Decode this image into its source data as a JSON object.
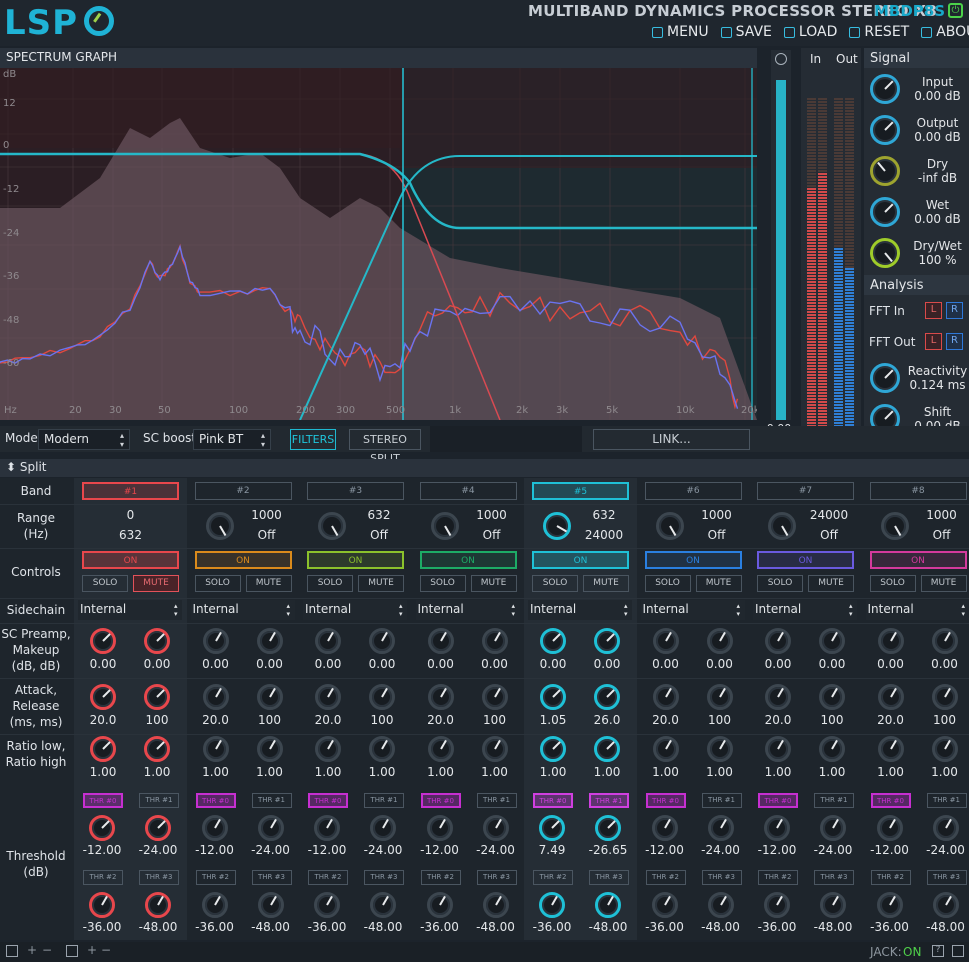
{
  "app": {
    "logo": "LSP",
    "title": "MULTIBAND DYNAMICS PROCESSOR STEREO X8",
    "id": "MBDP8S"
  },
  "menu": [
    {
      "label": "MENU",
      "icon": "menu-icon"
    },
    {
      "label": "SAVE",
      "icon": "save-icon"
    },
    {
      "label": "LOAD",
      "icon": "load-icon"
    },
    {
      "label": "RESET",
      "icon": "reset-icon"
    },
    {
      "label": "ABOUT",
      "icon": "about-icon"
    }
  ],
  "spectrum": {
    "title": "SPECTRUM GRAPH",
    "db_labels": [
      "dB",
      "12",
      "0",
      "-12",
      "-24",
      "-36",
      "-48",
      "-60"
    ],
    "hz_labels": [
      "Hz",
      "20",
      "30",
      "50",
      "100",
      "200",
      "300",
      "500",
      "1k",
      "2k",
      "3k",
      "5k",
      "10k",
      "20k"
    ]
  },
  "meters": {
    "zoom_value": "0.00",
    "zoom_unit": "dB",
    "in_label": "In",
    "out_label": "Out",
    "in_peak": [
      "-8.38",
      "-8.18"
    ],
    "out_peak": [
      "-31.2",
      "-30.8"
    ]
  },
  "signal": {
    "title": "Signal",
    "knobs": [
      {
        "name": "Input",
        "value": "0.00 dB"
      },
      {
        "name": "Output",
        "value": "0.00 dB"
      },
      {
        "name": "Dry",
        "value": "-inf dB"
      },
      {
        "name": "Wet",
        "value": "0.00 dB"
      },
      {
        "name": "Dry/Wet",
        "value": "100 %"
      }
    ]
  },
  "analysis": {
    "title": "Analysis",
    "fft_in": "FFT In",
    "fft_out": "FFT Out",
    "l": "L",
    "r": "R",
    "reactivity_label": "Reactivity",
    "reactivity": "0.124 ms",
    "shift_label": "Shift",
    "shift": "0.00 dB"
  },
  "controls": {
    "mode_label": "Mode:",
    "mode": "Modern",
    "boost_label": "SC boost:",
    "boost": "Pink BT",
    "filters": "FILTERS",
    "stereo_split": "STEREO SPLIT",
    "link": "LINK..."
  },
  "split": {
    "title": "Split",
    "row_labels": {
      "band": "Band",
      "range": "Range\n(Hz)",
      "controls": "Controls",
      "sidechain": "Sidechain",
      "preamp": "SC Preamp,\nMakeup\n(dB, dB)",
      "attack": "Attack,\nRelease\n(ms, ms)",
      "ratio": "Ratio low,\nRatio high",
      "threshold": "Threshold\n(dB)"
    },
    "on": "ON",
    "solo": "SOLO",
    "mute": "MUTE"
  },
  "bands": [
    {
      "label": "#1",
      "color": "#e8474c",
      "active": true,
      "range_top": "0",
      "range_bot": "632",
      "side": "Internal",
      "preamp": "0.00",
      "makeup": "0.00",
      "attack": "20.0",
      "release": "100",
      "rlow": "1.00",
      "rhigh": "1.00",
      "thr": [
        "-12.00",
        "-24.00",
        "-36.00",
        "-48.00"
      ]
    },
    {
      "label": "#2",
      "color": "#d98a1c",
      "active": false,
      "range_top": "1000",
      "range_bot": "Off",
      "side": "Internal",
      "preamp": "0.00",
      "makeup": "0.00",
      "attack": "20.0",
      "release": "100",
      "rlow": "1.00",
      "rhigh": "1.00",
      "thr": [
        "-12.00",
        "-24.00",
        "-36.00",
        "-48.00"
      ]
    },
    {
      "label": "#3",
      "color": "#8bc12c",
      "active": false,
      "range_top": "632",
      "range_bot": "Off",
      "side": "Internal",
      "preamp": "0.00",
      "makeup": "0.00",
      "attack": "20.0",
      "release": "100",
      "rlow": "1.00",
      "rhigh": "1.00",
      "thr": [
        "-12.00",
        "-24.00",
        "-36.00",
        "-48.00"
      ]
    },
    {
      "label": "#4",
      "color": "#1dab66",
      "active": false,
      "range_top": "1000",
      "range_bot": "Off",
      "side": "Internal",
      "preamp": "0.00",
      "makeup": "0.00",
      "attack": "20.0",
      "release": "100",
      "rlow": "1.00",
      "rhigh": "1.00",
      "thr": [
        "-12.00",
        "-24.00",
        "-36.00",
        "-48.00"
      ]
    },
    {
      "label": "#5",
      "color": "#1fc0d6",
      "active": true,
      "range_top": "632",
      "range_bot": "24000",
      "side": "Internal",
      "preamp": "0.00",
      "makeup": "0.00",
      "attack": "1.05",
      "release": "26.0",
      "rlow": "1.00",
      "rhigh": "1.00",
      "thr": [
        "7.49",
        "-26.65",
        "-36.00",
        "-48.00"
      ]
    },
    {
      "label": "#6",
      "color": "#2a7fe0",
      "active": false,
      "range_top": "1000",
      "range_bot": "Off",
      "side": "Internal",
      "preamp": "0.00",
      "makeup": "0.00",
      "attack": "20.0",
      "release": "100",
      "rlow": "1.00",
      "rhigh": "1.00",
      "thr": [
        "-12.00",
        "-24.00",
        "-36.00",
        "-48.00"
      ]
    },
    {
      "label": "#7",
      "color": "#6a5adf",
      "active": false,
      "range_top": "24000",
      "range_bot": "Off",
      "side": "Internal",
      "preamp": "0.00",
      "makeup": "0.00",
      "attack": "20.0",
      "release": "100",
      "rlow": "1.00",
      "rhigh": "1.00",
      "thr": [
        "-12.00",
        "-24.00",
        "-36.00",
        "-48.00"
      ]
    },
    {
      "label": "#8",
      "color": "#d33a9c",
      "active": false,
      "range_top": "1000",
      "range_bot": "Off",
      "side": "Internal",
      "preamp": "0.00",
      "makeup": "0.00",
      "attack": "20.0",
      "release": "100",
      "rlow": "1.00",
      "rhigh": "1.00",
      "thr": [
        "-12.00",
        "-24.00",
        "-36.00",
        "-48.00"
      ]
    }
  ],
  "thr_labels": [
    "THR #0",
    "THR #1",
    "THR #2",
    "THR #3"
  ],
  "status": {
    "jack_label": "JACK:",
    "jack_state": "ON"
  }
}
